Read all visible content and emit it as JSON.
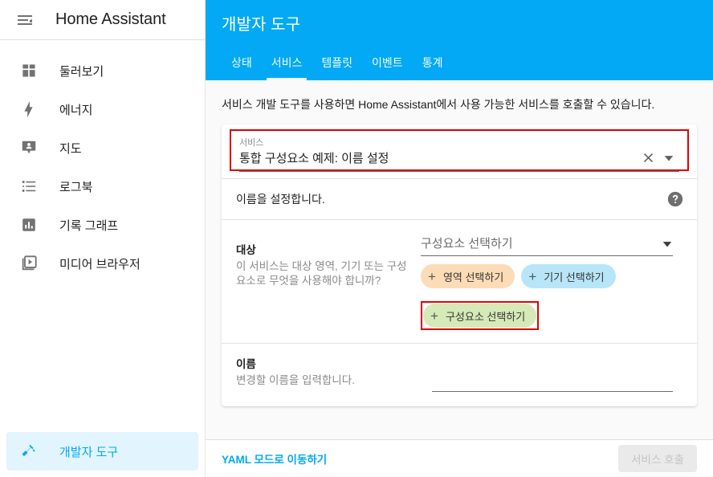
{
  "sidebar": {
    "menu_icon": "menu-open-icon",
    "title": "Home Assistant",
    "items": [
      {
        "label": "둘러보기",
        "icon": "view-dashboard-icon"
      },
      {
        "label": "에너지",
        "icon": "lightning-bolt-icon"
      },
      {
        "label": "지도",
        "icon": "map-marker-account-icon"
      },
      {
        "label": "로그북",
        "icon": "format-list-bulleted-icon"
      },
      {
        "label": "기록 그래프",
        "icon": "chart-box-icon"
      },
      {
        "label": "미디어 브라우저",
        "icon": "play-box-multiple-icon"
      }
    ],
    "bottom_item": {
      "label": "개발자 도구",
      "icon": "hammer-wrench-icon"
    },
    "active_color": "#03a9f4",
    "active_bg": "#e2f4fd"
  },
  "header": {
    "title": "개발자 도구",
    "accent": "#03a9f4",
    "tabs": [
      {
        "label": "상태",
        "active": false
      },
      {
        "label": "서비스",
        "active": true
      },
      {
        "label": "템플릿",
        "active": false
      },
      {
        "label": "이벤트",
        "active": false
      },
      {
        "label": "통계",
        "active": false
      }
    ]
  },
  "main": {
    "intro": "서비스 개발 도구를 사용하면 Home Assistant에서 사용 가능한 서비스를 호출할 수 있습니다.",
    "service_picker": {
      "label": "서비스",
      "value": "통합 구성요소 예제: 이름 설정",
      "clear_icon": "close-icon",
      "dropdown_icon": "chevron-down-icon",
      "highlight_color": "#e00000"
    },
    "service_description": {
      "text": "이름을 설정합니다.",
      "help_icon": "help-circle-icon"
    },
    "target_field": {
      "name": "대상",
      "description": "이 서비스는 대상 영역, 기기 또는 구성요소로 무엇을 사용해야 합니까?",
      "entity_placeholder": "구성요소 선택하기",
      "entity_dropdown_icon": "chevron-down-icon",
      "chips": [
        {
          "label": "영역 선택하기",
          "bg": "#fcdcb6",
          "highlighted": false,
          "plus": "+"
        },
        {
          "label": "기기 선택하기",
          "bg": "#b8e5f8",
          "highlighted": false,
          "plus": "+"
        },
        {
          "label": "구성요소 선택하기",
          "bg": "#d6e9b8",
          "highlighted": true,
          "plus": "+"
        }
      ]
    },
    "name_field": {
      "name": "이름",
      "description": "변경할 이름을 입력합니다.",
      "value": "",
      "placeholder": ""
    }
  },
  "footer": {
    "yaml_link": "YAML 모드로 이동하기",
    "call_button": "서비스 호출",
    "call_button_disabled": true
  }
}
